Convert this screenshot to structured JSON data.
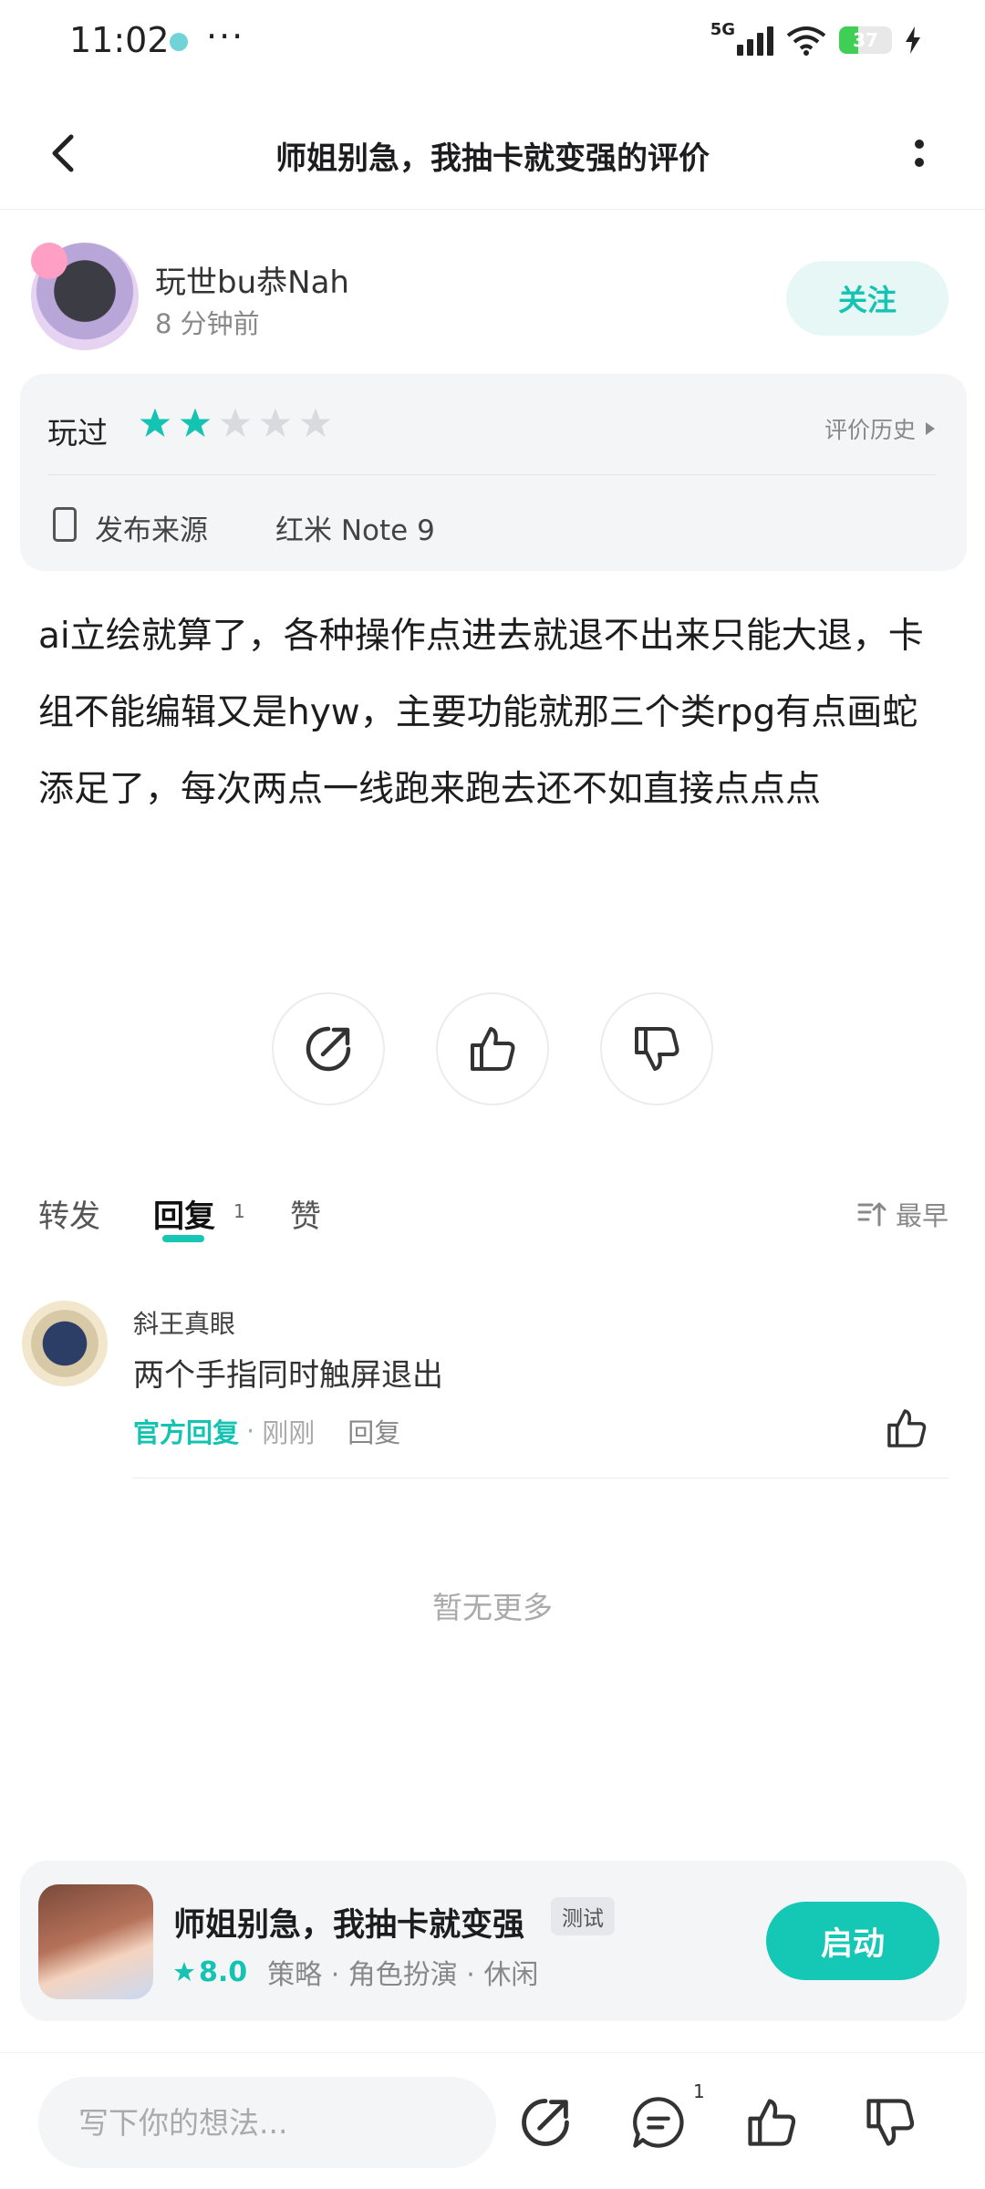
{
  "status_bar": {
    "time": "11:02",
    "dots": "···",
    "network": "5G",
    "battery": "37",
    "battery_level": 0.37
  },
  "header": {
    "title": "师姐别急，我抽卡就变强的评价"
  },
  "review": {
    "author": "玩世bu恭Nah",
    "time": "8 分钟前",
    "follow_label": "关注",
    "played_label": "玩过",
    "rating": 2,
    "rating_max": 5,
    "history_label": "评价历史",
    "source_label": "发布来源",
    "device": "红米 Note 9",
    "text": "ai立绘就算了，各种操作点进去就退不出来只能大退，卡组不能编辑又是hyw，主要功能就那三个类rpg有点画蛇添足了，每次两点一线跑来跑去还不如直接点点点"
  },
  "tabs": {
    "items": [
      {
        "label": "转发"
      },
      {
        "label": "回复",
        "count": "1"
      },
      {
        "label": "赞"
      }
    ],
    "sort_label": "最早"
  },
  "replies": [
    {
      "author": "斜王真眼",
      "content": "两个手指同时触屏退出",
      "official": "官方回复",
      "dot": "·",
      "time": "刚刚",
      "action": "回复"
    }
  ],
  "no_more": "暂无更多",
  "game": {
    "name": "师姐别急，我抽卡就变强",
    "badge": "测试",
    "score": "8.0",
    "tags": "策略 · 角色扮演 · 休闲",
    "launch_label": "启动"
  },
  "bottom_bar": {
    "placeholder": "写下你的想法...",
    "reply_count": "1"
  },
  "colors": {
    "accent": "#14c3b2",
    "star_off": "#d9dadd"
  }
}
